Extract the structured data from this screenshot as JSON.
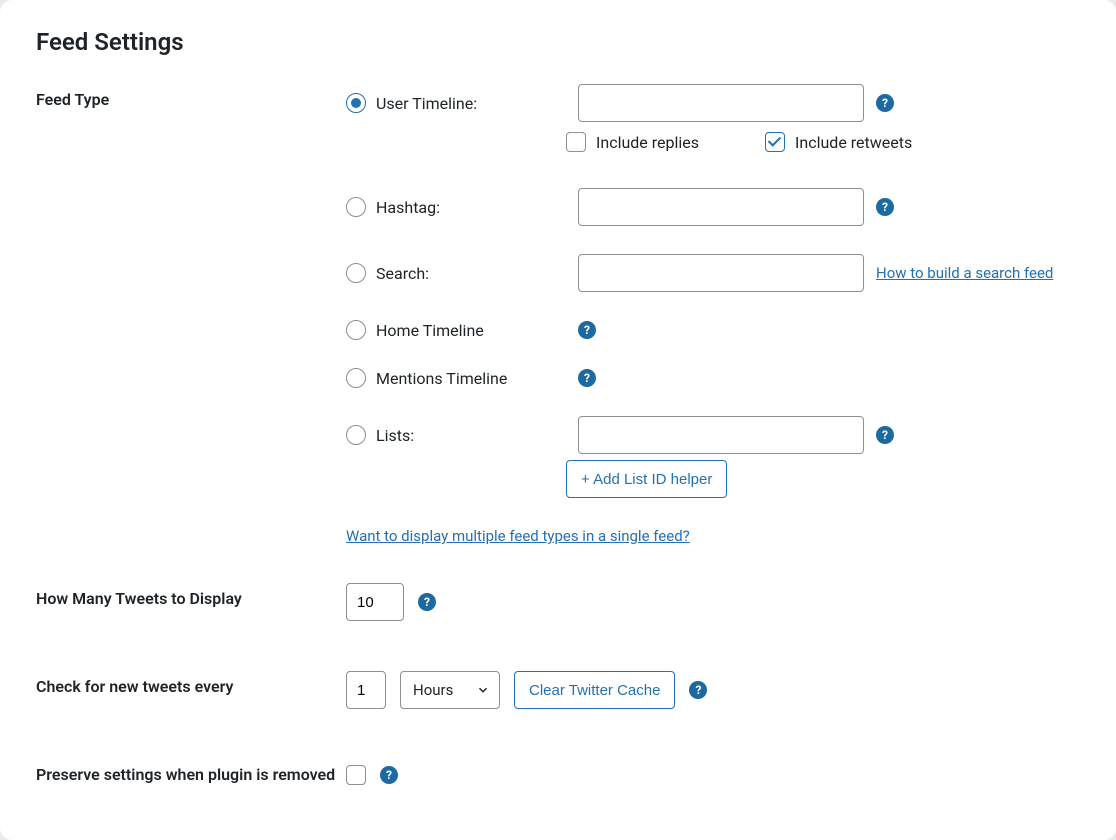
{
  "title": "Feed Settings",
  "labels": {
    "feedType": "Feed Type",
    "howMany": "How Many Tweets to Display",
    "checkEvery": "Check for new tweets every",
    "preserve": "Preserve settings when plugin is removed"
  },
  "feedType": {
    "options": {
      "userTimeline": "User Timeline:",
      "hashtag": "Hashtag:",
      "search": "Search:",
      "homeTimeline": "Home Timeline",
      "mentionsTimeline": "Mentions Timeline",
      "lists": "Lists:"
    },
    "includeReplies": "Include replies",
    "includeRetweets": "Include retweets",
    "searchHelpLink": "How to build a search feed",
    "addListHelper": "+ Add List ID helper",
    "multiFeedLink": "Want to display multiple feed types in a single feed?",
    "values": {
      "userTimeline": "",
      "hashtag": "",
      "search": "",
      "lists": ""
    }
  },
  "howMany": {
    "value": "10"
  },
  "checkEvery": {
    "value": "1",
    "unit": "Hours",
    "clearCache": "Clear Twitter Cache"
  },
  "help": "?"
}
